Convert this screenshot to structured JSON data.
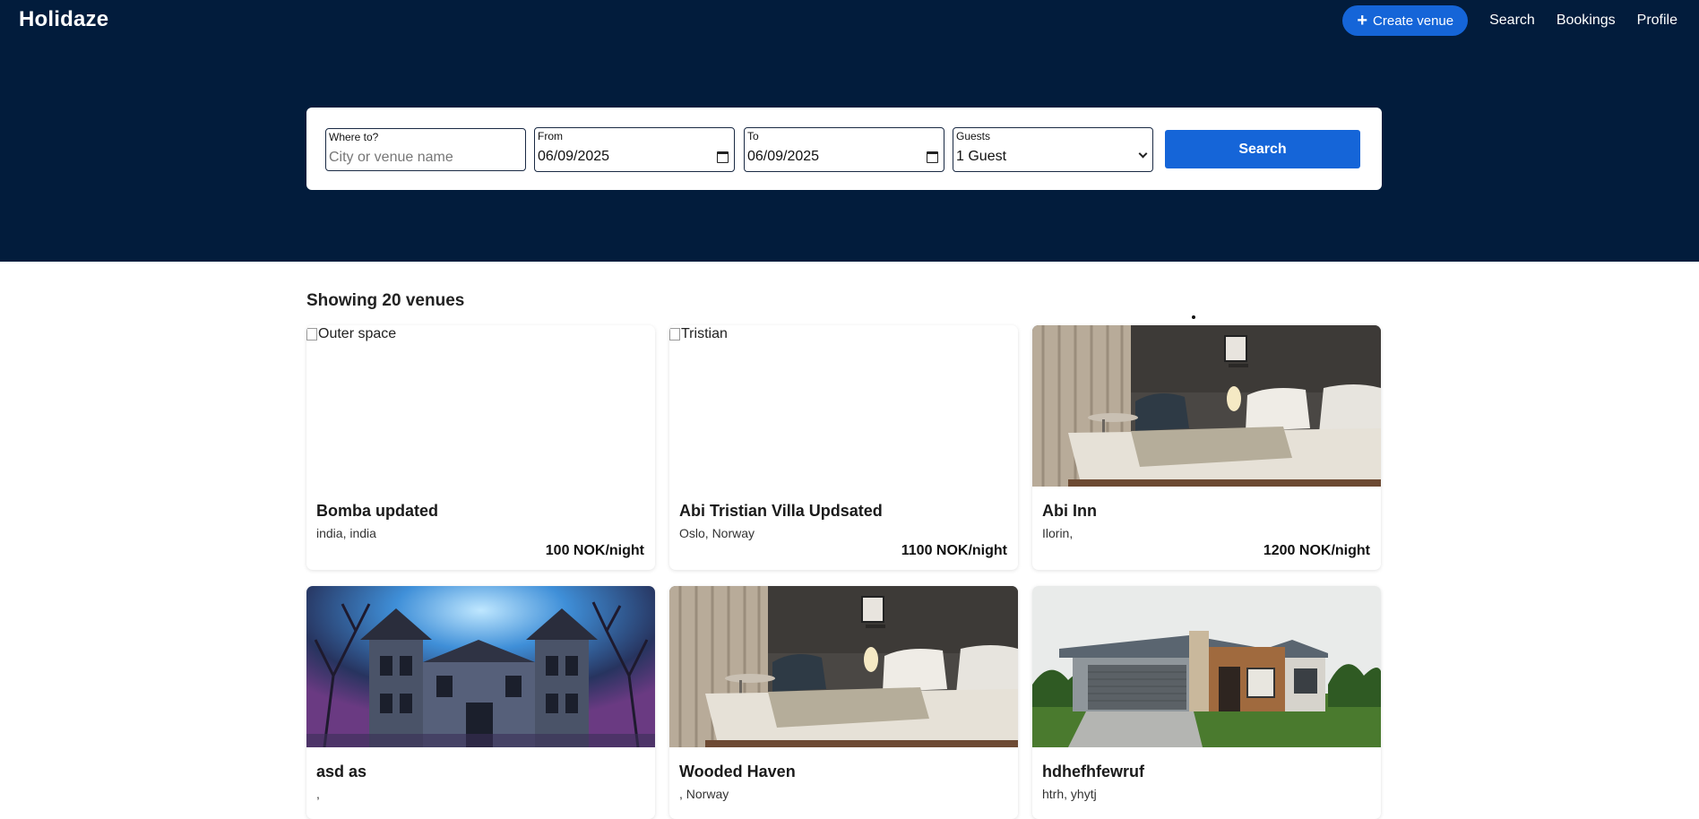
{
  "app": {
    "logo": "Holidaze"
  },
  "nav": {
    "create_label": "Create venue",
    "links": [
      "Search",
      "Bookings",
      "Profile"
    ]
  },
  "search": {
    "where_label": "Where to?",
    "where_placeholder": "City or venue name",
    "from_label": "From",
    "from_value": "06/09/2025",
    "to_label": "To",
    "to_value": "06/09/2025",
    "guests_label": "Guests",
    "guests_value": "1 Guest",
    "button_label": "Search"
  },
  "results": {
    "showing_text": "Showing 20 venues"
  },
  "venues": [
    {
      "name": "Bomba updated",
      "location": "india, india",
      "price": "100 NOK/night",
      "image_alt": "Outer space",
      "image": "broken"
    },
    {
      "name": "Abi Tristian Villa Updsated",
      "location": "Oslo, Norway",
      "price": "1100 NOK/night",
      "image_alt": "Tristian",
      "image": "broken"
    },
    {
      "name": "Abi Inn",
      "location": "Ilorin,",
      "price": "1200 NOK/night",
      "image": "bedroom"
    },
    {
      "name": "asd as",
      "location": ",",
      "price": "",
      "image": "haunted-house"
    },
    {
      "name": "Wooded Haven",
      "location": ", Norway",
      "price": "",
      "image": "bedroom"
    },
    {
      "name": "hdhefhfewruf",
      "location": "htrh, yhytj",
      "price": "",
      "image": "modern-house"
    }
  ],
  "colors": {
    "header_bg": "#021c3c",
    "accent": "#1565d8"
  }
}
